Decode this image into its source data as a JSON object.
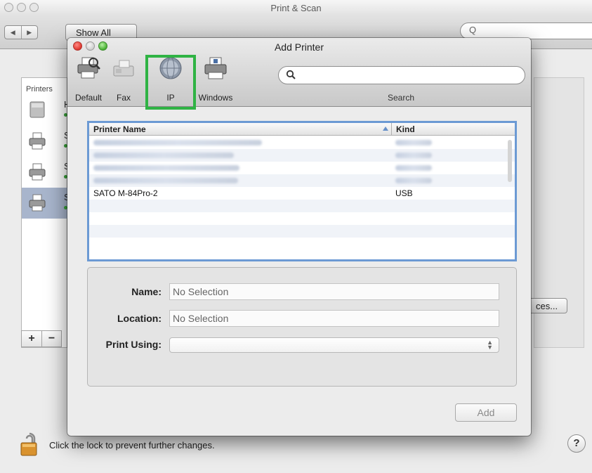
{
  "background_window": {
    "title": "Print & Scan",
    "nav_back": "◀",
    "nav_forward": "▶",
    "show_all_label": "Show All",
    "search_placeholder": "Q",
    "printers_label": "Printers",
    "printer_letters": [
      "H",
      "S",
      "S",
      "S"
    ],
    "preferences_button_partial": "ces...",
    "add_symbol": "+",
    "remove_symbol": "−",
    "lock_text": "Click the lock to prevent further changes.",
    "help_symbol": "?"
  },
  "sheet": {
    "title": "Add Printer",
    "toolbar": [
      {
        "label": "Default",
        "icon": "default-printer-icon"
      },
      {
        "label": "Fax",
        "icon": "fax-icon"
      },
      {
        "label": "IP",
        "icon": "ip-globe-icon"
      },
      {
        "label": "Windows",
        "icon": "windows-printer-icon"
      }
    ],
    "search_label": "Search",
    "table": {
      "columns": [
        "Printer Name",
        "Kind"
      ],
      "rows": [
        {
          "name": "",
          "kind": "",
          "blurred": true
        },
        {
          "name": "",
          "kind": "",
          "blurred": true
        },
        {
          "name": "",
          "kind": "",
          "blurred": true
        },
        {
          "name": "",
          "kind": "",
          "blurred": true
        },
        {
          "name": "SATO M-84Pro-2",
          "kind": "USB",
          "blurred": false
        }
      ]
    },
    "fields": {
      "name_label": "Name:",
      "name_value": "No Selection",
      "location_label": "Location:",
      "location_value": "No Selection",
      "print_using_label": "Print Using:",
      "print_using_value": ""
    },
    "add_button": "Add"
  },
  "colors": {
    "highlight": "#2fb344",
    "table_focus": "#6c9ad4",
    "selected_row": "#a8b5cc"
  }
}
